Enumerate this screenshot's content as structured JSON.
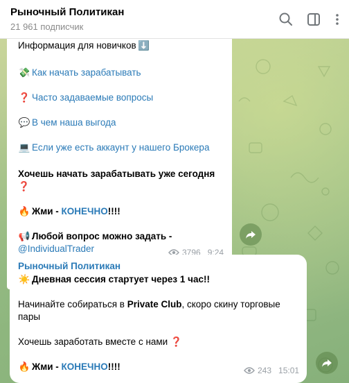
{
  "header": {
    "title": "Рыночный Политикан",
    "subscribers": "21 961 подписчик"
  },
  "message1": {
    "intro": "Информация для новичков",
    "links": [
      {
        "emoji": "💸",
        "text": "Как начать зарабатывать"
      },
      {
        "emoji": "❓",
        "text": "Часто задаваемые вопросы"
      },
      {
        "emoji": "💬",
        "text": "В чем наша выгода"
      },
      {
        "emoji": "💻",
        "text": "Если уже есть аккаунт у нашего Брокера"
      }
    ],
    "cta_line1": "Хочешь начать зарабатывать уже сегодня",
    "cta_q": "❓",
    "press_emoji": "🔥",
    "press_prefix": "Жми - ",
    "press_link": "КОНЕЧНО",
    "press_suffix": "!!!!",
    "question_emoji": "📢",
    "question_text": "Любой вопрос можно задать -",
    "handle": "@IndividualTrader",
    "views": "3796",
    "time": "9:24"
  },
  "message2": {
    "channel": "Рыночный Политикан",
    "sun_emoji": "☀️",
    "session": "Дневная сессия стартует через 1 час!!",
    "gather_prefix": "Начинайте собираться в ",
    "gather_bold": "Private Club",
    "gather_suffix": ", скоро скину торговые",
    "gather_line2": "пары",
    "earn_text": "Хочешь заработать вместе с нами",
    "earn_q": "❓",
    "press_emoji": "🔥",
    "press_prefix": "Жми - ",
    "press_link": "КОНЕЧНО",
    "press_suffix": "!!!!",
    "views": "243",
    "time": "15:01"
  },
  "icons": {
    "search": "search-icon",
    "sidebar": "sidebar-toggle-icon",
    "more": "more-vertical-icon",
    "share": "share-arrow-icon",
    "views": "eye-icon"
  }
}
